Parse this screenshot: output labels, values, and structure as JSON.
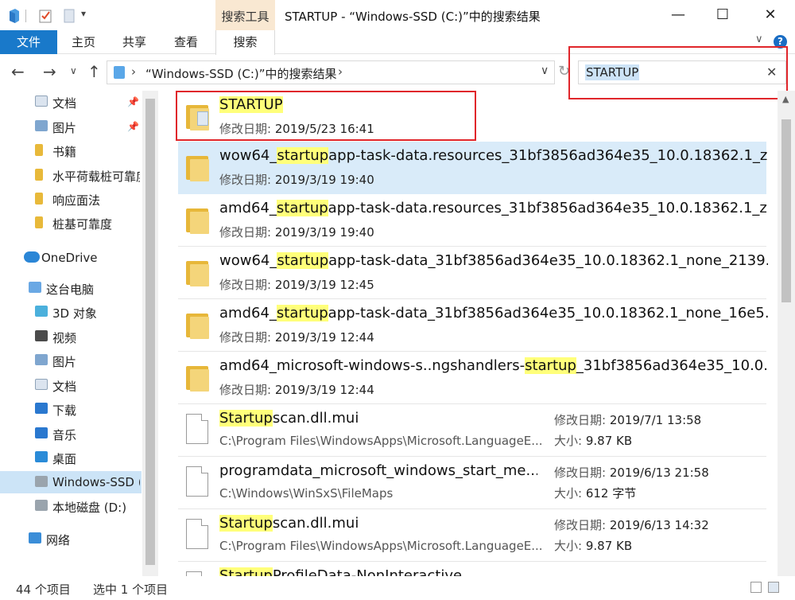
{
  "window": {
    "title": "STARTUP - “Windows-SSD (C:)”中的搜索结果",
    "context_tab": "搜索工具",
    "minimize": "—",
    "maximize": "☐",
    "close": "✕"
  },
  "ribbon": {
    "tabs": [
      "文件",
      "主页",
      "共享",
      "查看",
      "搜索"
    ],
    "expand": "∨",
    "help": "?"
  },
  "address": {
    "back": "←",
    "forward": "→",
    "recent": "∨",
    "up": "↑",
    "sep": "›",
    "path": "“Windows-SSD (C:)”中的搜索结果",
    "dropdown": "∨",
    "refresh": "↻"
  },
  "search": {
    "query": "STARTUP",
    "clear": "✕"
  },
  "nav": {
    "items": [
      {
        "label": "文档",
        "icon": "document-icon",
        "pinned": true
      },
      {
        "label": "图片",
        "icon": "pictures-icon",
        "pinned": true
      },
      {
        "label": "书籍",
        "icon": "folder-icon"
      },
      {
        "label": "水平荷载桩可靠度",
        "icon": "folder-icon"
      },
      {
        "label": "响应面法",
        "icon": "folder-icon"
      },
      {
        "label": "桩基可靠度",
        "icon": "folder-icon"
      },
      {
        "label": "OneDrive",
        "icon": "onedrive-icon"
      },
      {
        "label": "这台电脑",
        "icon": "this-pc-icon"
      },
      {
        "label": "3D 对象",
        "icon": "3d-objects-icon"
      },
      {
        "label": "视频",
        "icon": "videos-icon"
      },
      {
        "label": "图片",
        "icon": "pictures-icon"
      },
      {
        "label": "文档",
        "icon": "document-icon"
      },
      {
        "label": "下载",
        "icon": "download-icon"
      },
      {
        "label": "音乐",
        "icon": "music-icon"
      },
      {
        "label": "桌面",
        "icon": "desktop-icon"
      },
      {
        "label": "Windows-SSD (",
        "icon": "drive-c-icon",
        "selected": true
      },
      {
        "label": "本地磁盘 (D:)",
        "icon": "drive-d-icon"
      },
      {
        "label": "网络",
        "icon": "network-icon"
      }
    ],
    "pin_glyph": "📌"
  },
  "results": {
    "date_label": "修改日期:",
    "size_label": "大小:",
    "items": [
      {
        "pre": "",
        "hl": "STARTUP",
        "post": "",
        "date": "2019/5/23 16:41",
        "kind": "folder"
      },
      {
        "pre": "wow64_",
        "hl": "startup",
        "post": "app-task-data.resources_31bf3856ad364e35_10.0.18362.1_z...",
        "date": "2019/3/19 19:40",
        "kind": "folder",
        "selected": true
      },
      {
        "pre": "amd64_",
        "hl": "startup",
        "post": "app-task-data.resources_31bf3856ad364e35_10.0.18362.1_z...",
        "date": "2019/3/19 19:40",
        "kind": "folder"
      },
      {
        "pre": "wow64_",
        "hl": "startup",
        "post": "app-task-data_31bf3856ad364e35_10.0.18362.1_none_2139...",
        "date": "2019/3/19 12:45",
        "kind": "folder"
      },
      {
        "pre": "amd64_",
        "hl": "startup",
        "post": "app-task-data_31bf3856ad364e35_10.0.18362.1_none_16e5...",
        "date": "2019/3/19 12:44",
        "kind": "folder"
      },
      {
        "pre": "amd64_microsoft-windows-s..ngshandlers-",
        "hl": "startup",
        "post": "_31bf3856ad364e35_10.0...",
        "date": "2019/3/19 12:44",
        "kind": "folder"
      },
      {
        "pre": "",
        "hl": "Startup",
        "post": "scan.dll.mui",
        "path": "C:\\Program Files\\WindowsApps\\Microsoft.LanguageE...",
        "date": "2019/7/1 13:58",
        "size": "9.87 KB",
        "kind": "file"
      },
      {
        "pre": "programdata_microsoft_windows_start_me...",
        "hl": "",
        "post": "",
        "path": "C:\\Windows\\WinSxS\\FileMaps",
        "date": "2019/6/13 21:58",
        "size": "612 字节",
        "kind": "file"
      },
      {
        "pre": "",
        "hl": "Startup",
        "post": "scan.dll.mui",
        "path": "C:\\Program Files\\WindowsApps\\Microsoft.LanguageE...",
        "date": "2019/6/13 14:32",
        "size": "9.87 KB",
        "kind": "file"
      },
      {
        "pre": "",
        "hl": "Startup",
        "post": "ProfileData-NonInteractive",
        "path": "",
        "date": "",
        "kind": "file"
      }
    ]
  },
  "status": {
    "count": "44 个项目",
    "selected": "选中 1 个项目"
  }
}
